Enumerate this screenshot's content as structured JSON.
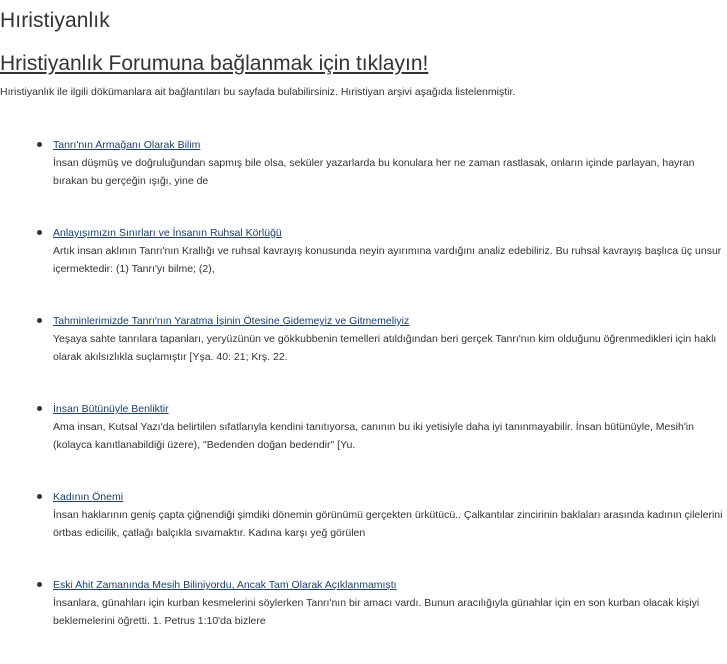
{
  "header": {
    "title": "Hıristiyanlık",
    "forum_link": "Hristiyanlık Forumuna bağlanmak için tıklayın!",
    "intro": "Hıristiyanlık ile ilgili dökümanlara ait bağlantıları bu sayfada bulabilirsiniz. Hıristiyan arşivi aşağıda listelenmiştir."
  },
  "articles": [
    {
      "title": "Tanrı'nın Armağanı Olarak Bilim",
      "description": "İnsan düşmüş ve doğruluğundan sapmış bile olsa, seküler yazarlarda bu konulara her ne zaman rastlasak, onların içinde parlayan, hayran bırakan bu gerçeğin ışığı, yine de"
    },
    {
      "title": "Anlayışımızın Sınırları ve İnsanın Ruhsal Körlüğü",
      "description": "Artık insan aklının Tanrı'nın Krallığı ve ruhsal kavrayış konusunda neyin ayırımına vardığını analiz edebiliriz. Bu ruhsal kavrayış başlıca üç unsur içermektedir: (1) Tanrı'yı bilme; (2),"
    },
    {
      "title": "Tahminlerimizde Tanrı'nın Yaratma İşinin Ötesine Gidemeyiz ve Gitmemeliyiz",
      "description": "Yeşaya sahte tanrılara tapanları, yeryüzünün ve gökkubbenin temelleri atıldığından beri gerçek Tanrı'nın kim olduğunu öğrenmedikleri için haklı olarak akılsızlıkla suçlamıştır [Yşa. 40: 21; Krş. 22."
    },
    {
      "title": "İnsan Bütünüyle Benliktir",
      "description": "Ama insan, Kutsal Yazı'da belirtilen sıfatlarıyla kendini tanıtıyorsa, canının bu iki yetisiyle daha iyi tanınmayabilir. İnsan bütünüyle, Mesih'in (kolayca kanıtlanabildiği üzere), \"Bedenden doğan bedendir\" [Yu."
    },
    {
      "title": "Kadının Önemi",
      "description": "İnsan haklarının geniş çapta çiğnendiği şimdiki dönemin görünümü gerçekten ürkütücü.. Çalkantılar zincirinin baklaları arasında kadının çilelerini örtbas edicilik, çatlağı balçıkla sıvamaktır. Kadına karşı yeğ görülen"
    },
    {
      "title": "Eski Ahit Zamanında Mesih Biliniyordu, Ancak Tam Olarak Açıklanmamıştı",
      "description": "İnsanlara, günahları için kurban kesmelerini söylerken Tanrı'nın bir amacı vardı. Bunun aracılığıyla günahlar için en son kurban olacak kişiyi beklemelerini öğretti. 1. Petrus 1:10'da bizlere"
    }
  ]
}
